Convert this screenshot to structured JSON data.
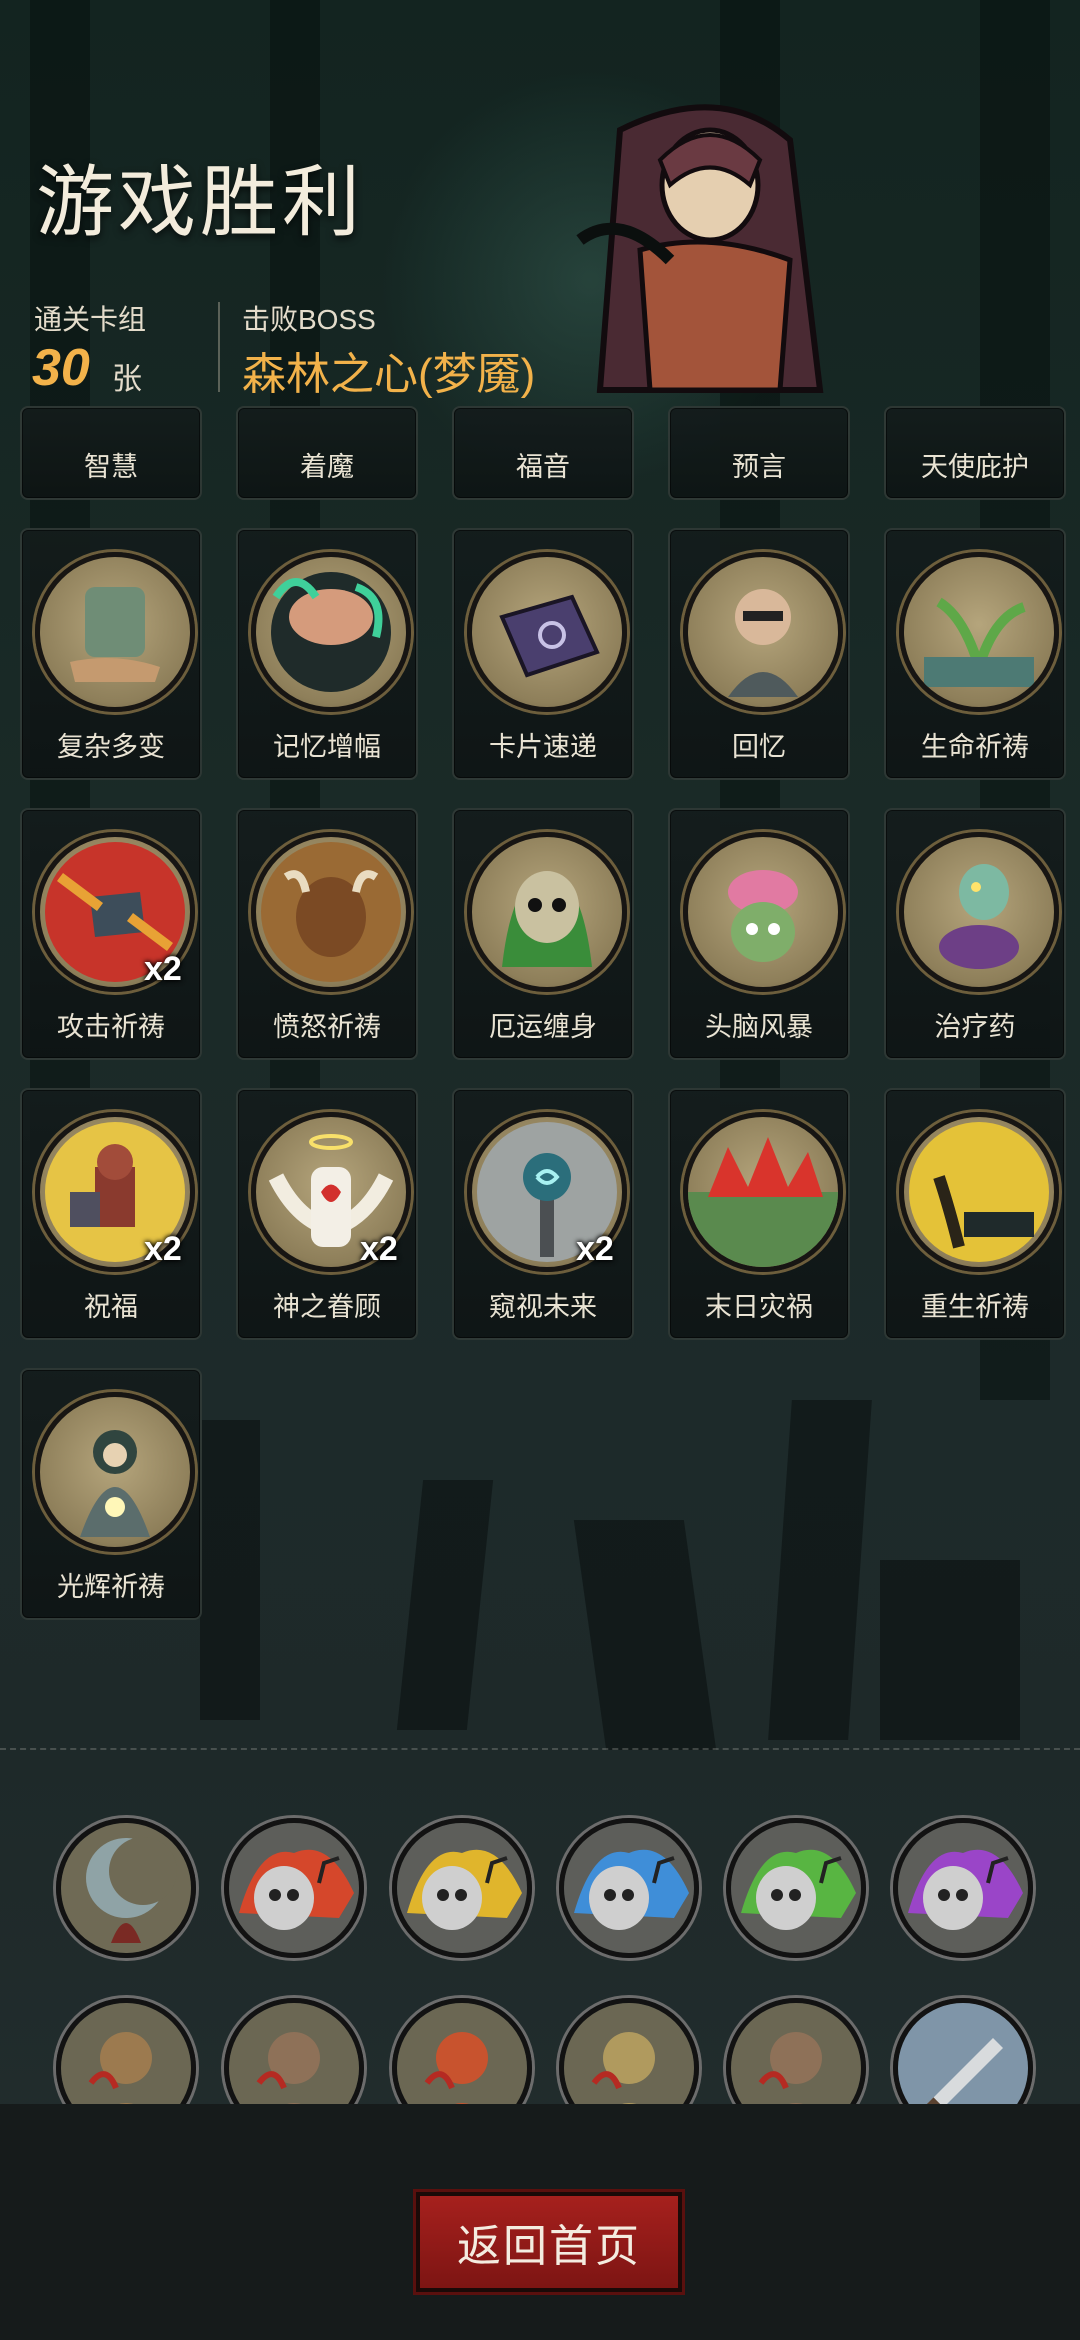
{
  "header": {
    "title": "游戏胜利",
    "deck_label": "通关卡组",
    "deck_count": "30",
    "deck_unit": "张",
    "boss_label": "击败BOSS",
    "boss_name": "森林之心(梦魇)"
  },
  "cards_partial": [
    {
      "name": "智慧"
    },
    {
      "name": "着魔"
    },
    {
      "name": "福音"
    },
    {
      "name": "预言"
    },
    {
      "name": "天使庇护"
    }
  ],
  "cards": [
    {
      "name": "复杂多变",
      "icon": "stone-hand-icon",
      "badge": ""
    },
    {
      "name": "记忆增幅",
      "icon": "brain-icon",
      "badge": ""
    },
    {
      "name": "卡片速递",
      "icon": "card-icon",
      "badge": ""
    },
    {
      "name": "回忆",
      "icon": "old-man-icon",
      "badge": ""
    },
    {
      "name": "生命祈祷",
      "icon": "sprout-icon",
      "badge": ""
    },
    {
      "name": "攻击祈祷",
      "icon": "fist-icon",
      "badge": "x2"
    },
    {
      "name": "愤怒祈祷",
      "icon": "minotaur-icon",
      "badge": ""
    },
    {
      "name": "厄运缠身",
      "icon": "skull-icon",
      "badge": ""
    },
    {
      "name": "头脑风暴",
      "icon": "zombie-brain-icon",
      "badge": ""
    },
    {
      "name": "治疗药",
      "icon": "potion-icon",
      "badge": ""
    },
    {
      "name": "祝福",
      "icon": "knight-icon",
      "badge": "x2"
    },
    {
      "name": "神之眷顾",
      "icon": "angel-icon",
      "badge": "x2"
    },
    {
      "name": "窥视未来",
      "icon": "crystal-staff-icon",
      "badge": "x2"
    },
    {
      "name": "末日灾祸",
      "icon": "eruption-icon",
      "badge": ""
    },
    {
      "name": "重生祈祷",
      "icon": "altar-icon",
      "badge": ""
    },
    {
      "name": "光辉祈祷",
      "icon": "priest-icon",
      "badge": ""
    }
  ],
  "relics": [
    {
      "icon": "moon-icon",
      "color": "#8fa3a6"
    },
    {
      "icon": "flame-skull-red-icon",
      "color": "#d5472b"
    },
    {
      "icon": "flame-skull-yellow-icon",
      "color": "#e0b52c"
    },
    {
      "icon": "flame-skull-blue-icon",
      "color": "#3f8ed8"
    },
    {
      "icon": "flame-skull-green-icon",
      "color": "#58b542"
    },
    {
      "icon": "flame-skull-purple-icon",
      "color": "#9a45c8"
    },
    {
      "icon": "hooded-rogue-icon",
      "color": "#9c7a4f"
    },
    {
      "icon": "bloody-hands-icon",
      "color": "#8e7158"
    },
    {
      "icon": "red-demon-icon",
      "color": "#c8532e"
    },
    {
      "icon": "wizard-icon",
      "color": "#b09a5e"
    },
    {
      "icon": "bloody-hands-icon",
      "color": "#8e7158"
    },
    {
      "icon": "dagger-icon",
      "color": "#7f95a8"
    }
  ],
  "footer": {
    "home_button": "返回首页"
  }
}
